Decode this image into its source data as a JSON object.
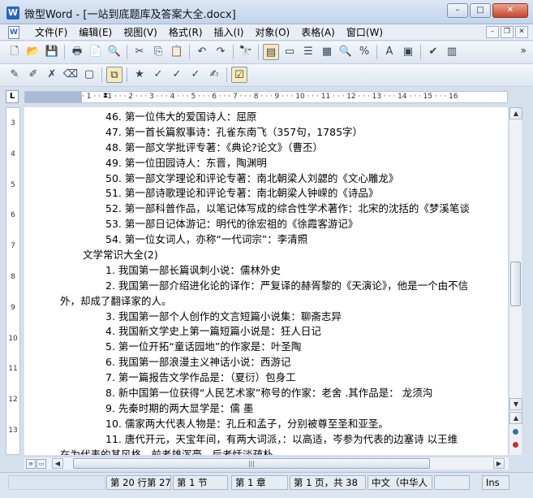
{
  "window": {
    "title": "微型Word - [一站到底题库及答案大全.docx]",
    "app_icon": "W",
    "buttons": {
      "minimize": "–",
      "maximize": "□",
      "close": "✕"
    }
  },
  "menu": {
    "doc_icon": "W",
    "items": [
      "文件(F)",
      "编辑(E)",
      "视图(V)",
      "格式(R)",
      "插入(I)",
      "对象(O)",
      "表格(A)",
      "窗口(W)"
    ],
    "mdi": {
      "minimize": "–",
      "restore": "❐",
      "close": "✕"
    }
  },
  "toolbar1": {
    "icons": [
      "new-document-icon",
      "open-folder-icon",
      "save-icon",
      "print-icon",
      "pdf-icon",
      "print-preview-icon",
      "cut-icon",
      "copy-icon",
      "paste-icon",
      "undo-icon",
      "redo-icon",
      "find-icon",
      "page-view-icon",
      "text-box-icon",
      "outline-icon",
      "table-icon",
      "zoom-icon",
      "percent-icon",
      "font-color-icon",
      "highlight-icon",
      "spellcheck-icon",
      "chart-icon"
    ],
    "more": "»"
  },
  "toolbar2": {
    "icons": [
      "edit-icon",
      "pencil-icon",
      "delete-icon",
      "eraser-icon",
      "comment-icon",
      "track-changes-icon",
      "accept-icon",
      "accept-all-icon",
      "reject-icon",
      "reject-all-icon",
      "review-icon",
      "review-pane-icon"
    ]
  },
  "ruler": {
    "corner": "L",
    "ticks": "· 1 · · · 1 · · · 2 · · · 3 · · · 4 · · · 5 · · · 6 · · · 7 · · · 8 · · · 9 · · · 10 · · · 11 · · · 12 · · · 13 · · · 14 · · · 15 · · · 16",
    "vertical": [
      "3",
      "4",
      "5",
      "6",
      "7",
      "8",
      "9",
      "10",
      "11",
      "12",
      "13"
    ]
  },
  "document": {
    "lines": [
      {
        "text": "46. 第一位伟大的爱国诗人：屈原",
        "indent": true
      },
      {
        "text": "47. 第一首长篇叙事诗：孔雀东南飞（357句，1785字）",
        "indent": true
      },
      {
        "text": "48. 第一部文学批评专著：《典论?论文》（曹丕）",
        "indent": true
      },
      {
        "text": "49. 第一位田园诗人：东晋，陶渊明",
        "indent": true
      },
      {
        "text": "50. 第一部文学理论和评论专著：南北朝梁人刘勰的《文心雕龙》",
        "indent": true
      },
      {
        "text": "51. 第一部诗歌理论和评论专著：南北朝梁人钟嵘的《诗品》",
        "indent": true
      },
      {
        "text": "52. 第一部科普作品，以笔记体写成的综合性学术著作：北宋的沈括的《梦溪笔谈",
        "indent": true
      },
      {
        "text": "53. 第一部日记体游记：明代的徐宏祖的《徐霞客游记》",
        "indent": true
      },
      {
        "text": "54. 第一位女词人，亦称“一代词宗”：李清照",
        "indent": true
      },
      {
        "text": "文学常识大全(2)",
        "indent": false
      },
      {
        "text": "1. 我国第一部长篇讽刺小说：儒林外史",
        "indent": true
      },
      {
        "text": "2. 我国第一部介绍进化论的译作：严复译的赫胥黎的《天演论》，他是一个由不信",
        "indent": true
      },
      {
        "text": "外，却成了翻译家的人。",
        "indent": false,
        "wrap": true
      },
      {
        "text": "3. 我国第一部个人创作的文言短篇小说集：聊斋志异",
        "indent": true
      },
      {
        "text": "4. 我国新文学史上第一篇短篇小说是：狂人日记",
        "indent": true
      },
      {
        "text": "5. 第一位开拓“童话园地”的作家是：叶圣陶",
        "indent": true
      },
      {
        "text": "6. 我国第一部浪漫主义神话小说：西游记",
        "indent": true
      },
      {
        "text": "7. 第一篇报告文学作品是：（夏衍）包身工",
        "indent": true
      },
      {
        "text": "8. 新中国第一位获得“人民艺术家”称号的作家：老舍 .其作品是： 龙须沟",
        "indent": true
      },
      {
        "text": "9. 先秦时期的两大显学是：儒 墨",
        "indent": true
      },
      {
        "text": "10. 儒家两大代表人物是：孔丘和孟子，分别被尊至圣和亚圣。",
        "indent": true
      },
      {
        "text": "11. 唐代开元，天宝年间，有两大词派，：以高适，岑参为代表的边塞诗 以王维",
        "indent": true
      },
      {
        "text": "在为代表的其风格，前者雄浑豪，后者恬淡疏朴",
        "indent": false,
        "wrap": true
      }
    ]
  },
  "scroll": {
    "up": "▲",
    "down": "▼",
    "left": "◀",
    "right": "▶",
    "grip": "|||",
    "prev_page": "▲",
    "next_page": "▼"
  },
  "status": {
    "position": "第 20 行第 27",
    "section": "第 1 节",
    "chapter": "第 1 章",
    "page": "第 1 页，共 38",
    "language": "中文（中华人",
    "mode": "Ins"
  }
}
